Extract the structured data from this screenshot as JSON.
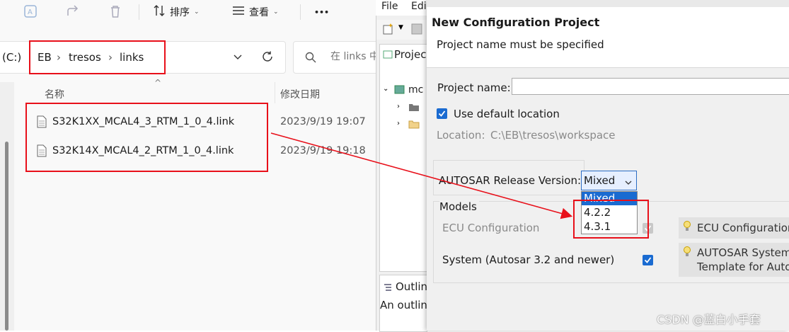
{
  "explorer": {
    "toolbar": {
      "sort_label": "排序",
      "view_label": "查看",
      "more_label": "•••"
    },
    "address": {
      "drive": "(C:)",
      "crumbs": [
        "EB",
        "tresos",
        "links"
      ],
      "separator": "›"
    },
    "search": {
      "placeholder": "在 links 中"
    },
    "columns": {
      "name": "名称",
      "modified": "修改日期",
      "sort_arrow": "^"
    },
    "files": [
      {
        "name": "S32K1XX_MCAL4_3_RTM_1_0_4.link",
        "modified": "2023/9/19 19:07"
      },
      {
        "name": "S32K14X_MCAL4_2_RTM_1_0_4.link",
        "modified": "2023/9/19 19:18"
      }
    ]
  },
  "eclipse": {
    "menu": [
      "File",
      "Edi"
    ],
    "project_view_label": "Projec",
    "tree_item": "mc",
    "outline_label": "Outlin",
    "outline_text": "An outlin"
  },
  "dialog": {
    "title": "New Configuration Project",
    "message": "Project name must be specified",
    "project_name_label": "Project name:",
    "project_name_value": "",
    "use_default_label": "Use default location",
    "location_label": "Location:",
    "location_value": "C:\\EB\\tresos\\workspace",
    "autosar_label": "AUTOSAR Release Version:",
    "autosar_selected": "Mixed",
    "autosar_options": [
      "Mixed",
      "4.2.2",
      "4.3.1"
    ],
    "models_label": "Models",
    "ecu_config_label": "ECU Configuration",
    "ecu_config_desc": "ECU Configuration",
    "system_label": "System (Autosar 3.2 and newer)",
    "system_desc_line1": "AUTOSAR System",
    "system_desc_line2": "Template for Auto"
  },
  "watermark": "CSDN @蓝白小手套",
  "colors": {
    "annotation_red": "#e8101a",
    "accent_blue": "#1a6bd1",
    "selection_blue": "#1a6bd1"
  }
}
